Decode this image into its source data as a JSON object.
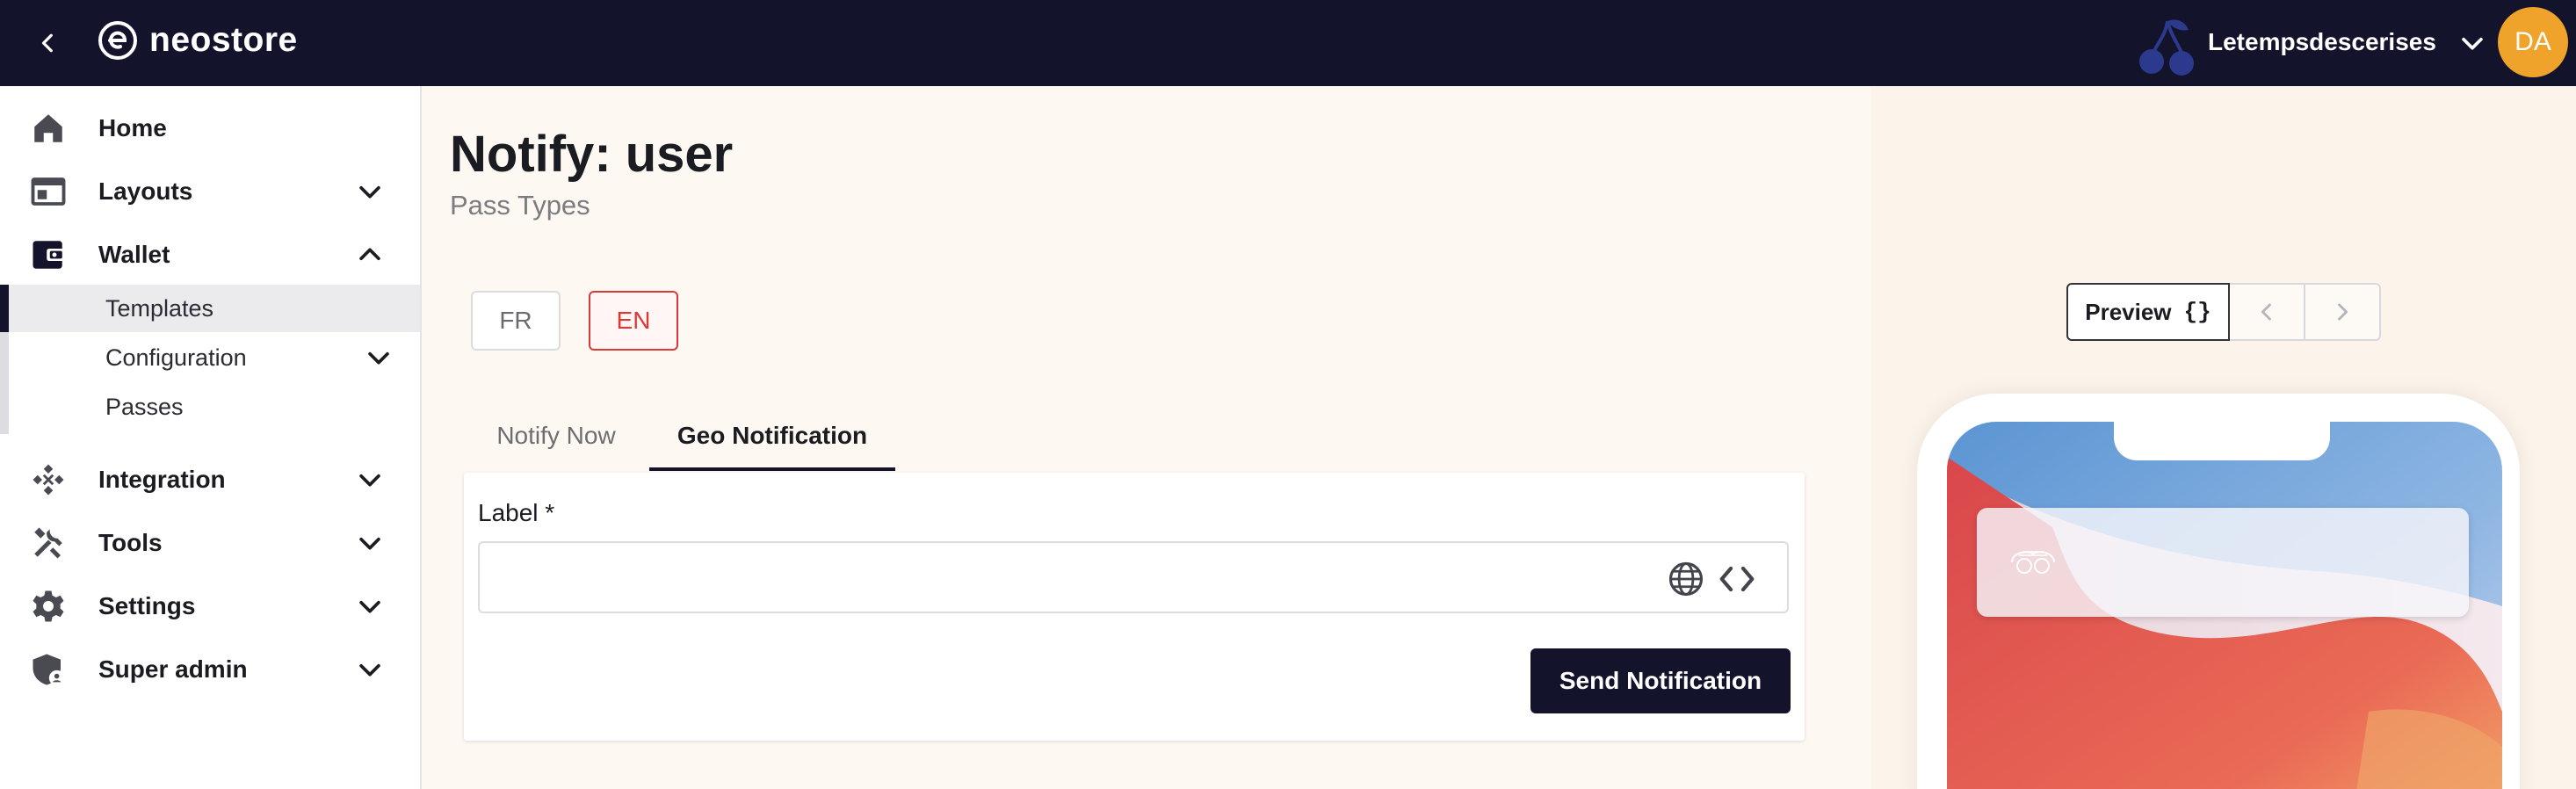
{
  "topbar": {
    "app_name": "neostore",
    "org_name": "Letempsdescerises",
    "avatar_initials": "DA",
    "colors": {
      "bar": "#13132c",
      "avatar": "#f0a32a",
      "org_logo": "#2b3a8c"
    }
  },
  "sidebar": {
    "items": [
      {
        "label": "Home",
        "icon": "home-icon"
      },
      {
        "label": "Layouts",
        "icon": "layout-icon",
        "expanded": false
      },
      {
        "label": "Wallet",
        "icon": "wallet-icon",
        "expanded": true
      },
      {
        "label": "Integration",
        "icon": "integration-icon",
        "expanded": false
      },
      {
        "label": "Tools",
        "icon": "tools-icon",
        "expanded": false
      },
      {
        "label": "Settings",
        "icon": "gear-icon",
        "expanded": false
      },
      {
        "label": "Super admin",
        "icon": "admin-shield-icon",
        "expanded": false
      }
    ],
    "wallet_children": [
      {
        "label": "Templates",
        "active": true
      },
      {
        "label": "Configuration",
        "expandable": true
      },
      {
        "label": "Passes"
      }
    ]
  },
  "main": {
    "title": "Notify: user",
    "subtitle": "Pass Types",
    "languages": [
      {
        "code": "FR",
        "selected": false
      },
      {
        "code": "EN",
        "selected": true
      }
    ],
    "tabs": [
      {
        "label": "Notify Now",
        "active": false
      },
      {
        "label": "Geo Notification",
        "active": true
      }
    ],
    "form": {
      "label_field": {
        "label": "Label *",
        "value": ""
      },
      "send_button": "Send Notification"
    },
    "accent_color": "#d93a36"
  },
  "preview": {
    "button_label": "Preview",
    "braces": "{}"
  }
}
